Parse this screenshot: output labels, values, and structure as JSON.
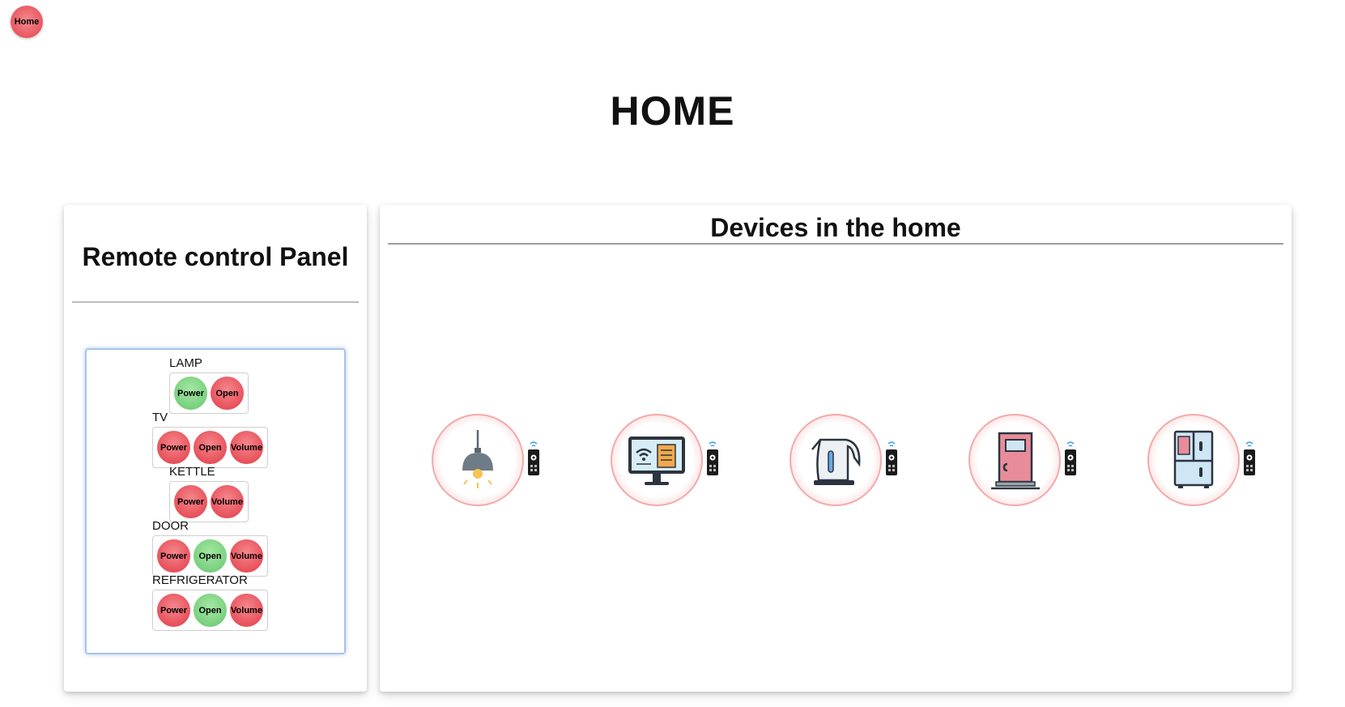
{
  "nav": {
    "home_label": "Home"
  },
  "page": {
    "title": "HOME"
  },
  "panel": {
    "title": "Remote control Panel",
    "devices": [
      {
        "name": "LAMP",
        "buttons": [
          {
            "label": "Power",
            "state": "on"
          },
          {
            "label": "Open",
            "state": "off"
          }
        ]
      },
      {
        "name": "TV",
        "buttons": [
          {
            "label": "Power",
            "state": "off"
          },
          {
            "label": "Open",
            "state": "off"
          },
          {
            "label": "Volume",
            "state": "off"
          }
        ]
      },
      {
        "name": "KETTLE",
        "buttons": [
          {
            "label": "Power",
            "state": "off"
          },
          {
            "label": "Volume",
            "state": "off"
          }
        ]
      },
      {
        "name": "DOOR",
        "buttons": [
          {
            "label": "Power",
            "state": "off"
          },
          {
            "label": "Open",
            "state": "on"
          },
          {
            "label": "Volume",
            "state": "off"
          }
        ]
      },
      {
        "name": "REFRIGERATOR",
        "buttons": [
          {
            "label": "Power",
            "state": "off"
          },
          {
            "label": "Open",
            "state": "on"
          },
          {
            "label": "Volume",
            "state": "off"
          }
        ]
      }
    ]
  },
  "devices_section": {
    "title": "Devices in the home",
    "devices": [
      {
        "icon": "lamp-icon"
      },
      {
        "icon": "tv-icon"
      },
      {
        "icon": "kettle-icon"
      },
      {
        "icon": "door-icon"
      },
      {
        "icon": "refrigerator-icon"
      }
    ]
  },
  "colors": {
    "button_on": "#79d07f",
    "button_off": "#e8515b",
    "remote_box_border": "#a9c3ec"
  }
}
